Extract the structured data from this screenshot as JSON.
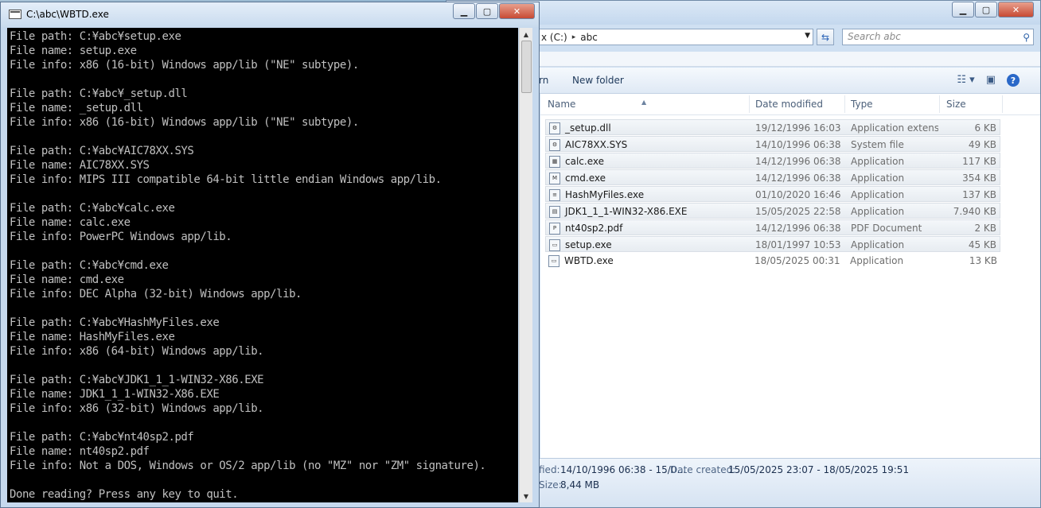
{
  "console": {
    "title": "C:\\abc\\WBTD.exe",
    "controls": {
      "minimize": "▁",
      "maximize": "▢",
      "close": "✕"
    },
    "output": "File path: C:¥abc¥setup.exe\nFile name: setup.exe\nFile info: x86 (16-bit) Windows app/lib (\"NE\" subtype).\n\nFile path: C:¥abc¥_setup.dll\nFile name: _setup.dll\nFile info: x86 (16-bit) Windows app/lib (\"NE\" subtype).\n\nFile path: C:¥abc¥AIC78XX.SYS\nFile name: AIC78XX.SYS\nFile info: MIPS III compatible 64-bit little endian Windows app/lib.\n\nFile path: C:¥abc¥calc.exe\nFile name: calc.exe\nFile info: PowerPC Windows app/lib.\n\nFile path: C:¥abc¥cmd.exe\nFile name: cmd.exe\nFile info: DEC Alpha (32-bit) Windows app/lib.\n\nFile path: C:¥abc¥HashMyFiles.exe\nFile name: HashMyFiles.exe\nFile info: x86 (64-bit) Windows app/lib.\n\nFile path: C:¥abc¥JDK1_1_1-WIN32-X86.EXE\nFile name: JDK1_1_1-WIN32-X86.EXE\nFile info: x86 (32-bit) Windows app/lib.\n\nFile path: C:¥abc¥nt40sp2.pdf\nFile name: nt40sp2.pdf\nFile info: Not a DOS, Windows or OS/2 app/lib (no \"MZ\" nor \"ZM\" signature).\n\nDone reading? Press any key to quit."
  },
  "explorer": {
    "controls": {
      "minimize": "▁",
      "maximize": "▢",
      "close": "✕"
    },
    "address": {
      "segment1": "x (C:)",
      "separator": "▸",
      "segment2": "abc"
    },
    "search_placeholder": "Search abc",
    "toolbar": {
      "item1": "rn",
      "new_folder": "New folder"
    },
    "columns": {
      "name": "Name",
      "date": "Date modified",
      "type": "Type",
      "size": "Size"
    },
    "files": [
      {
        "name": "_setup.dll",
        "date": "19/12/1996 16:03",
        "type": "Application extens...",
        "size": "6 KB",
        "icon": "dll-icon"
      },
      {
        "name": "AIC78XX.SYS",
        "date": "14/10/1996 06:38",
        "type": "System file",
        "size": "49 KB",
        "icon": "sys-file-icon"
      },
      {
        "name": "calc.exe",
        "date": "14/12/1996 06:38",
        "type": "Application",
        "size": "117 KB",
        "icon": "calc-icon"
      },
      {
        "name": "cmd.exe",
        "date": "14/12/1996 06:38",
        "type": "Application",
        "size": "354 KB",
        "icon": "cmd-icon"
      },
      {
        "name": "HashMyFiles.exe",
        "date": "01/10/2020 16:46",
        "type": "Application",
        "size": "137 KB",
        "icon": "hashmyfiles-icon"
      },
      {
        "name": "JDK1_1_1-WIN32-X86.EXE",
        "date": "15/05/2025 22:58",
        "type": "Application",
        "size": "7.940 KB",
        "icon": "installer-icon"
      },
      {
        "name": "nt40sp2.pdf",
        "date": "14/12/1996 06:38",
        "type": "PDF Document",
        "size": "2 KB",
        "icon": "pdf-icon"
      },
      {
        "name": "setup.exe",
        "date": "18/01/1997 10:53",
        "type": "Application",
        "size": "45 KB",
        "icon": "exe-icon"
      },
      {
        "name": "WBTD.exe",
        "date": "18/05/2025 00:31",
        "type": "Application",
        "size": "13 KB",
        "icon": "exe-icon"
      }
    ],
    "details": {
      "modified_label": "fied:",
      "modified_value": "14/10/1996 06:38 - 15/0...",
      "created_label": "Date created:",
      "created_value": "15/05/2025 23:07 - 18/05/2025 19:51",
      "size_label": "Size:",
      "size_value": "8,44 MB"
    }
  }
}
